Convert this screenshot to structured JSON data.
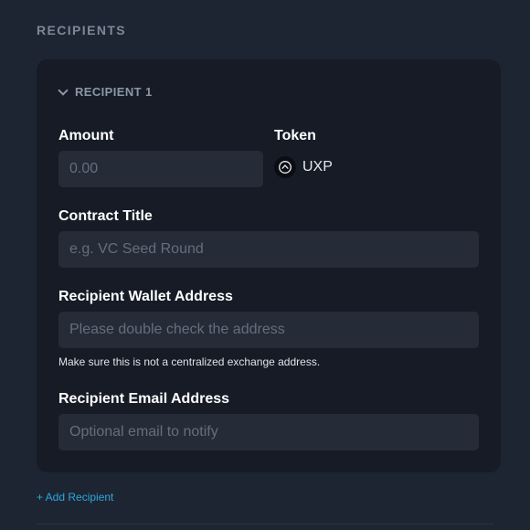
{
  "section": {
    "title": "RECIPIENTS"
  },
  "recipient": {
    "header": "RECIPIENT 1",
    "amount": {
      "label": "Amount",
      "placeholder": "0.00",
      "value": ""
    },
    "token": {
      "label": "Token",
      "name": "UXP",
      "icon": "uxp-token-icon"
    },
    "contract_title": {
      "label": "Contract Title",
      "placeholder": "e.g. VC Seed Round",
      "value": ""
    },
    "wallet_address": {
      "label": "Recipient Wallet Address",
      "placeholder": "Please double check the address",
      "value": "",
      "helper": "Make sure this is not a centralized exchange address."
    },
    "email_address": {
      "label": "Recipient Email Address",
      "placeholder": "Optional email to notify",
      "value": ""
    }
  },
  "actions": {
    "add_recipient": "+ Add Recipient"
  },
  "colors": {
    "background": "#1e2532",
    "card": "#161b26",
    "input": "#252c38",
    "accent": "#2aa8e0",
    "muted": "#7c8899"
  }
}
